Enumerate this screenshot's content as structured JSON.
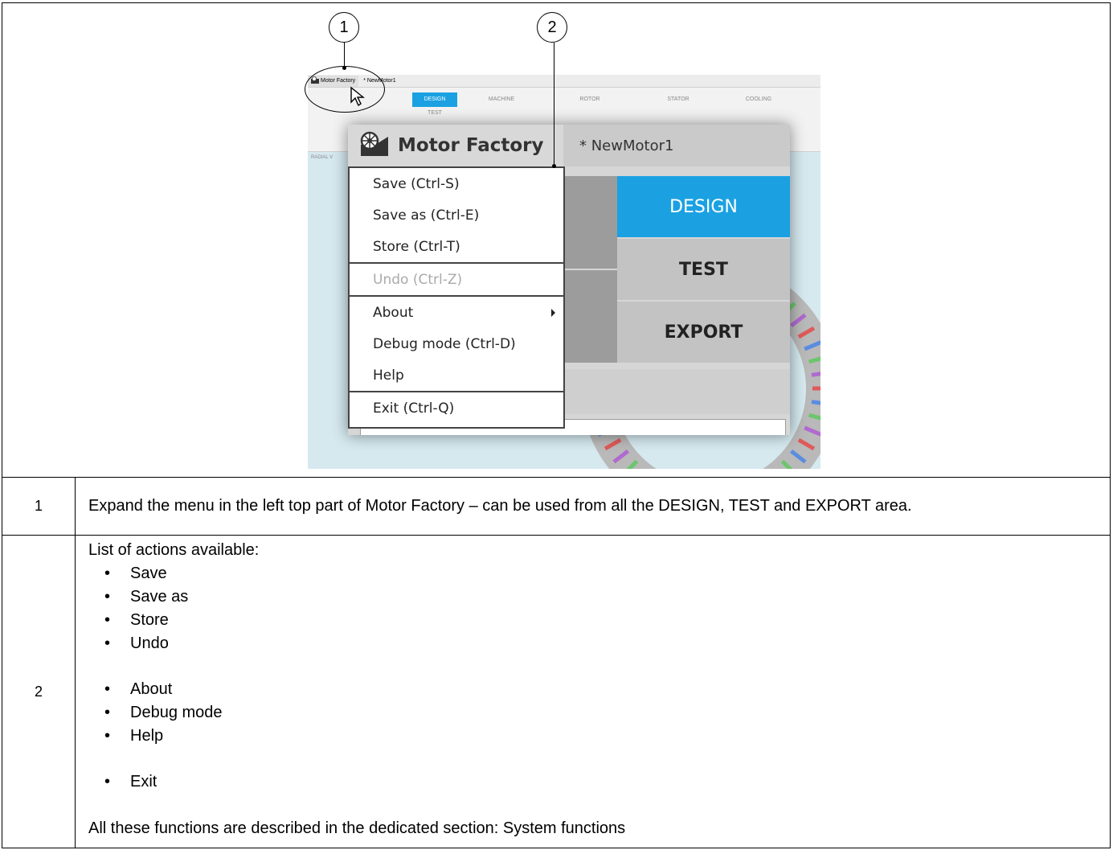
{
  "figure": {
    "topbar": {
      "app_name": "Motor Factory",
      "file_name": "* NewMotor1"
    },
    "ribbon_tabs": [
      "DESIGN",
      "MACHINE",
      "ROTOR",
      "STATOR",
      "COOLING"
    ],
    "ribbon_sub_tab": "TEST",
    "ribbon_side_label": "RADIAL V",
    "zoom": {
      "app_title": "Motor Factory",
      "file_name": "* NewMotor1",
      "menu_items": [
        {
          "label": "Save (Ctrl-S)"
        },
        {
          "label": "Save as (Ctrl-E)"
        },
        {
          "label": "Store (Ctrl-T)"
        },
        {
          "label": "Undo (Ctrl-Z)"
        },
        {
          "label": "About"
        },
        {
          "label": "Debug mode (Ctrl-D)"
        },
        {
          "label": "Help"
        },
        {
          "label": "Exit (Ctrl-Q)"
        }
      ],
      "modes": [
        "DESIGN",
        "TEST",
        "EXPORT"
      ]
    },
    "callouts": [
      "1",
      "2"
    ]
  },
  "rows": [
    {
      "number": "1",
      "text": "Expand the menu in the left top part of Motor Factory – can be used from all the DESIGN, TEST and EXPORT area."
    },
    {
      "number": "2",
      "intro": "List of actions available:",
      "group1": [
        "Save",
        "Save as",
        "Store",
        "Undo"
      ],
      "group2": [
        "About",
        "Debug mode",
        "Help"
      ],
      "group3": [
        "Exit"
      ],
      "closing": "All these functions are described in the dedicated section: System functions"
    }
  ]
}
